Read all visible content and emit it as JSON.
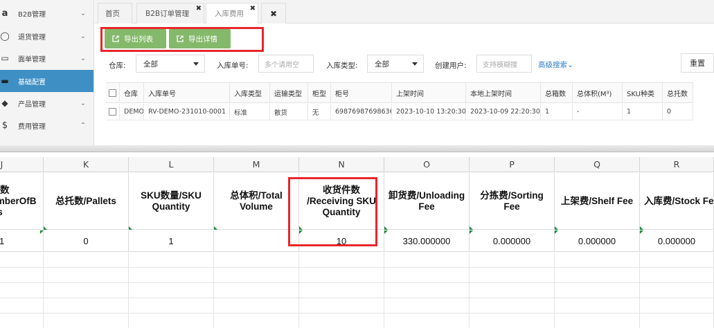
{
  "sidebar": {
    "items": [
      {
        "label": "B2B管理",
        "icon": "amazon-icon",
        "glyph": "a",
        "chevron": "⌄",
        "active": false
      },
      {
        "label": "退货管理",
        "icon": "return-icon",
        "glyph": "◯",
        "chevron": "⌄",
        "active": false
      },
      {
        "label": "面单管理",
        "icon": "document-icon",
        "glyph": "▭",
        "chevron": "⌄",
        "active": false
      },
      {
        "label": "基础配置",
        "icon": "folder-icon",
        "glyph": "▬",
        "chevron": "",
        "active": true
      },
      {
        "label": "产品管理",
        "icon": "tag-icon",
        "glyph": "◆",
        "chevron": "⌄",
        "active": false
      },
      {
        "label": "费用管理",
        "icon": "dollar-icon",
        "glyph": "$",
        "chevron": "⌃",
        "active": false
      }
    ]
  },
  "tabs": [
    {
      "label": "首页",
      "closable": false,
      "active": false
    },
    {
      "label": "B2B订单管理",
      "closable": true,
      "active": false
    },
    {
      "label": "入库费用",
      "closable": true,
      "active": true
    },
    {
      "label": "✖",
      "closable": false,
      "active": false
    }
  ],
  "toolbar": {
    "export_list": "导出列表",
    "export_detail": "导出详情"
  },
  "filters": {
    "warehouse_label": "仓库:",
    "warehouse_value": "全部",
    "inbound_no_label": "入库单号:",
    "inbound_no_placeholder": "多个请用空",
    "inbound_type_label": "入库类型:",
    "inbound_type_value": "全部",
    "creator_label": "创建用户:",
    "creator_placeholder": "支持模糊搜",
    "advanced_search": "高级搜索⌄",
    "reset": "重置"
  },
  "grid": {
    "headers": [
      "仓库",
      "入库单号",
      "入库类型",
      "运输类型",
      "柜型",
      "柜号",
      "上架时间",
      "本地上架时间",
      "总箱数",
      "总体积(M³)",
      "SKU种类",
      "总托数"
    ],
    "rows": [
      [
        "DEMO",
        "RV-DEMO-231010-0001",
        "标准",
        "散货",
        "无",
        "69876987698636",
        "2023-10-10 13:20:30",
        "2023-10-09 22:20:30",
        "1",
        "-",
        "1",
        "0"
      ]
    ]
  },
  "sheet": {
    "columns": [
      "J",
      "K",
      "L",
      "M",
      "N",
      "O",
      "P",
      "Q",
      "R"
    ],
    "headers": [
      "总箱数\n/NumberOfBoxes",
      "总托数/Pallets",
      "SKU数量/SKU Quantity",
      "总体积/Total Volume",
      "收货件数\n/Receiving SKU\nQuantity",
      "卸货费/Unloading Fee",
      "分拣费/Sorting Fee",
      "上架费/Shelf Fee",
      "入库费/Stock Fee"
    ],
    "values": [
      "1",
      "0",
      "1",
      "",
      "10",
      "330.000000",
      "0.000000",
      "0.000000",
      "0.000000"
    ],
    "colors": {
      "highlight": "#e8262b",
      "error_marker": "#1f8a3c"
    }
  }
}
